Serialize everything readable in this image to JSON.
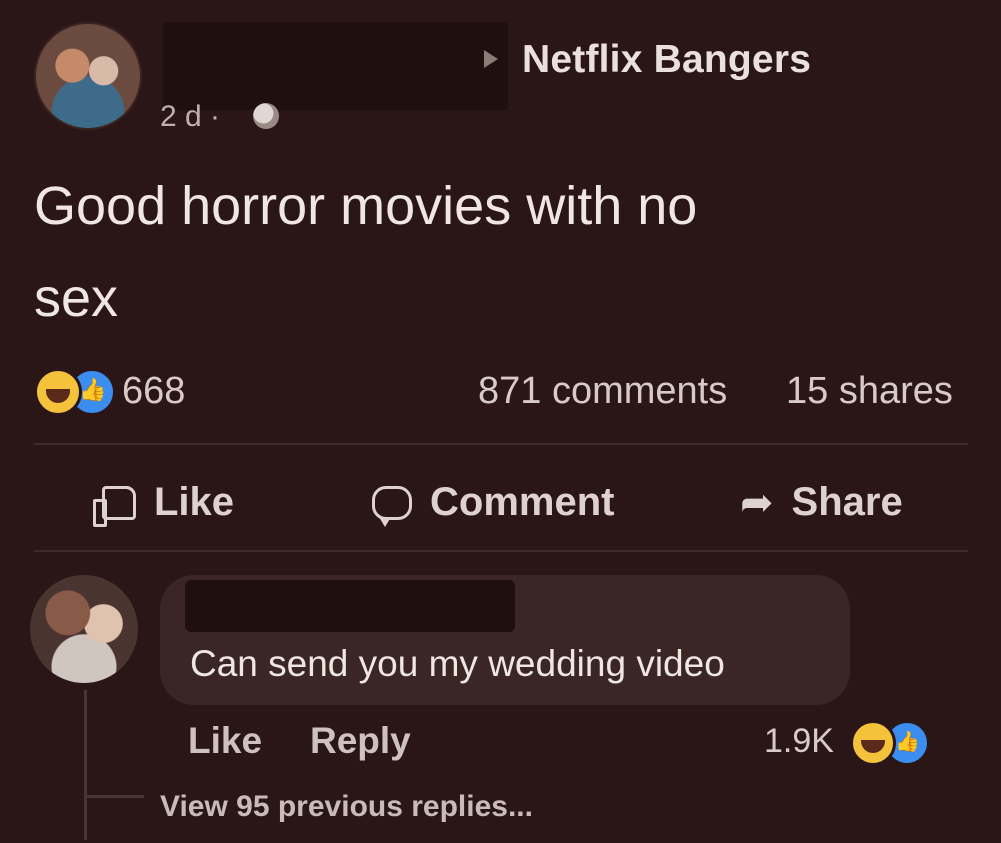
{
  "post": {
    "group_name": "Netflix Bangers",
    "time": "2 d ·",
    "text": "Good horror movies with no\nsex",
    "reactions": {
      "count": "668",
      "icons": [
        "haha-icon",
        "like-icon"
      ]
    },
    "comments_count": "871 comments",
    "shares_count": "15 shares"
  },
  "actions": {
    "like": "Like",
    "comment": "Comment",
    "share": "Share"
  },
  "comment": {
    "text": "Can send you my wedding video",
    "like": "Like",
    "reply": "Reply",
    "reactions_count": "1.9K",
    "view_replies": "View 95 previous replies..."
  },
  "colors": {
    "background": "#2a1616",
    "bubble": "#3a2624",
    "like_blue": "#3b8ef0",
    "haha_yellow": "#f5c33b"
  }
}
